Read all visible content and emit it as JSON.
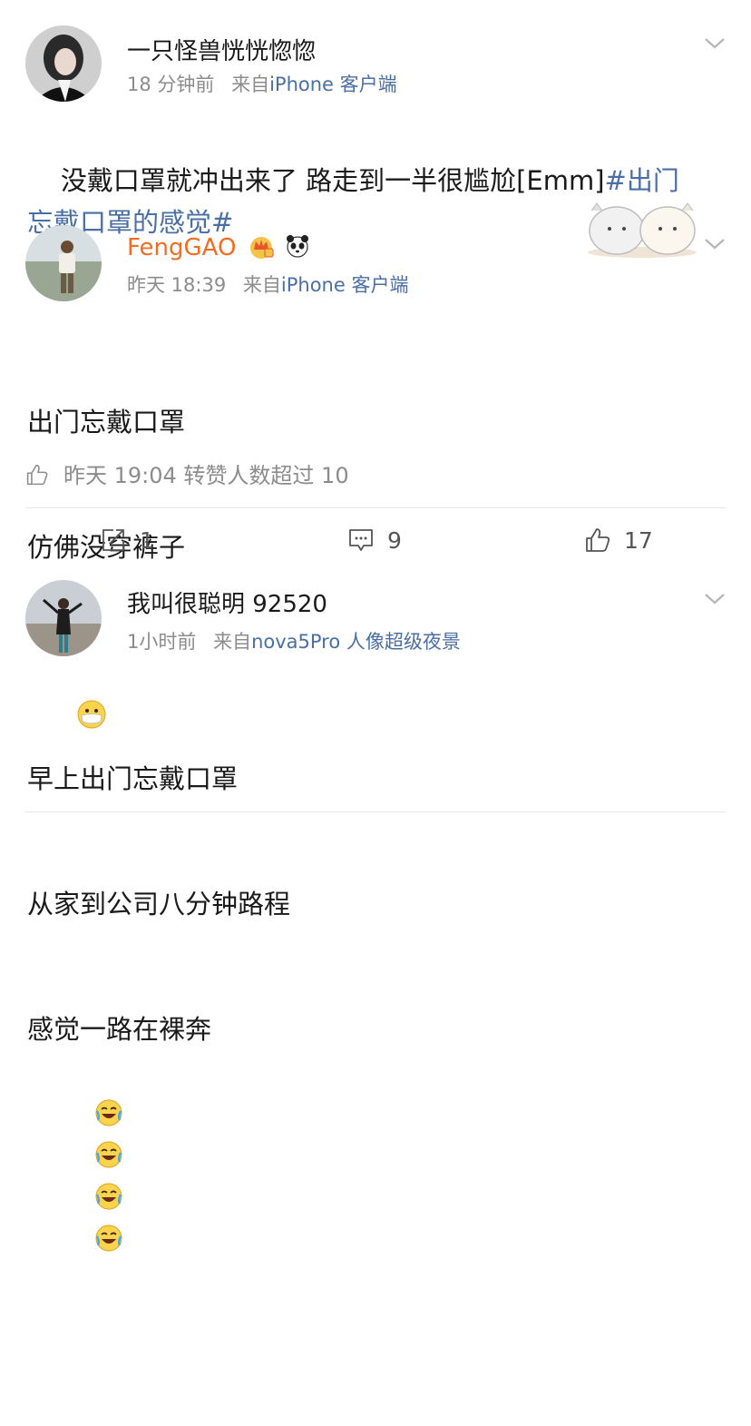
{
  "posts": [
    {
      "username": "一只怪兽恍恍惚惚",
      "time": "18 分钟前",
      "source_prefix": "来自",
      "source": "iPhone 客户端",
      "text_line1_main": "没戴口罩就冲出来了 路走到一半很尴尬[Emm]",
      "text_line1_tag": "#出门",
      "text_line2_tag": "忘戴口罩的感觉#"
    },
    {
      "username": "FengGAO",
      "time": "昨天 18:39",
      "source_prefix": "来自",
      "source": "iPhone 客户端",
      "lines": [
        "出门忘戴口罩",
        "仿佛没穿裤子"
      ],
      "like_text": "昨天 19:04 转赞人数超过 10"
    }
  ],
  "action_bar": {
    "repost_count": "1",
    "comment_count": "9",
    "like_count": "17"
  },
  "post3": {
    "username": "我叫很聪明 92520",
    "time": "1小时前",
    "source_prefix": "来自",
    "source": "nova5Pro 人像超级夜景",
    "lines": [
      "早上出门忘戴口罩",
      "从家到公司八分钟路程",
      "感觉一路在裸奔"
    ]
  },
  "colors": {
    "link": "#4a6fa5",
    "vip_name": "#f36c21",
    "meta_gray": "#8c8c8c"
  },
  "icons": [
    "chevron-down-icon",
    "crown-icon",
    "panda-icon",
    "mask-emoji-icon",
    "like-icon",
    "repost-icon",
    "comment-icon",
    "laugh-cry-emoji-icon"
  ]
}
